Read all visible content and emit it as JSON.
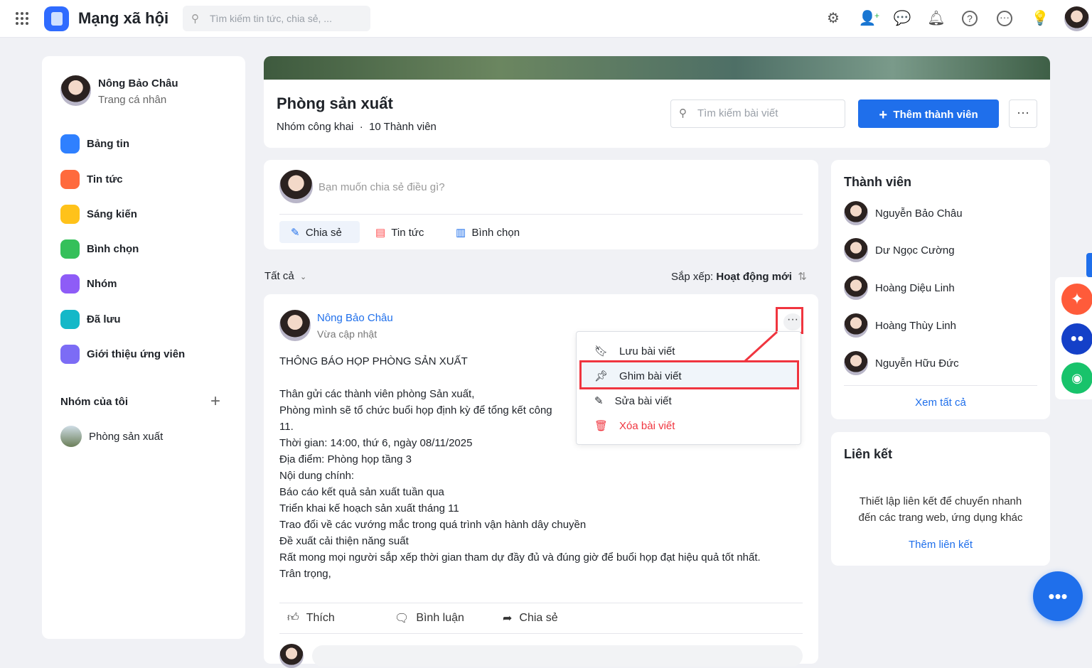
{
  "header": {
    "app_title": "Mạng xã hội",
    "search_placeholder": "Tìm kiếm tin tức, chia sẻ, ..."
  },
  "sidebar": {
    "profile_name": "Nông Bảo Châu",
    "profile_sub": "Trang cá nhân",
    "items": [
      {
        "label": "Bảng tin",
        "color": "#2f80ff"
      },
      {
        "label": "Tin tức",
        "color": "#ff6a3d"
      },
      {
        "label": "Sáng kiến",
        "color": "#ffc21a"
      },
      {
        "label": "Bình chọn",
        "color": "#35c05a"
      },
      {
        "label": "Nhóm",
        "color": "#8e5cf7"
      },
      {
        "label": "Đã lưu",
        "color": "#14b8c8"
      },
      {
        "label": "Giới thiệu ứng viên",
        "color": "#7c6cf5"
      }
    ],
    "my_groups_title": "Nhóm của tôi",
    "groups": [
      "Phòng sản xuất"
    ]
  },
  "group": {
    "name": "Phòng sản xuất",
    "type": "Nhóm công khai",
    "members_count": "10 Thành viên",
    "search_placeholder": "Tìm kiếm bài viết",
    "add_member": "Thêm thành viên"
  },
  "composer": {
    "placeholder": "Bạn muốn chia sẻ điều gì?",
    "tabs": [
      "Chia sẻ",
      "Tin tức",
      "Bình chọn"
    ]
  },
  "filter": {
    "all": "Tất cả",
    "sort_label": "Sắp xếp: ",
    "sort_value": "Hoạt động mới"
  },
  "post": {
    "author": "Nông Bảo Châu",
    "time": "Vừa cập nhật",
    "title": "THÔNG BÁO HỌP PHÒNG SẢN XUẤT",
    "lines": [
      "Thân gửi các thành viên phòng Sản xuất,",
      "Phòng mình sẽ tổ chức buổi họp định kỳ để tổng kết công",
      "11.",
      "Thời gian: 14:00, thứ 6, ngày 08/11/2025",
      "Địa điểm: Phòng họp tầng 3",
      "Nội dung chính:",
      "Báo cáo kết quả sản xuất tuần qua",
      "Triển khai kế hoạch sản xuất tháng 11",
      "Trao đổi về các vướng mắc trong quá trình vận hành dây chuyền",
      "Đề xuất cải thiện năng suất",
      "Rất mong mọi người sắp xếp thời gian tham dự đầy đủ và đúng giờ để buổi họp đạt hiệu quả tốt nhất.",
      "Trân trọng,"
    ],
    "actions": [
      "Thích",
      "Bình luận",
      "Chia sẻ"
    ]
  },
  "post_menu": {
    "items": [
      "Lưu bài viết",
      "Ghim bài viết",
      "Sửa bài viết",
      "Xóa bài viết"
    ]
  },
  "members": {
    "title": "Thành viên",
    "list": [
      "Nguyễn Bảo Châu",
      "Dư Ngọc Cường",
      "Hoàng Diệu Linh",
      "Hoàng Thùy Linh",
      "Nguyễn Hữu Đức"
    ],
    "see_all": "Xem tất cả"
  },
  "links": {
    "title": "Liên kết",
    "desc1": "Thiết lập liên kết để chuyển nhanh",
    "desc2": "đến các trang web, ứng dụng khác",
    "add": "Thêm liên kết"
  }
}
